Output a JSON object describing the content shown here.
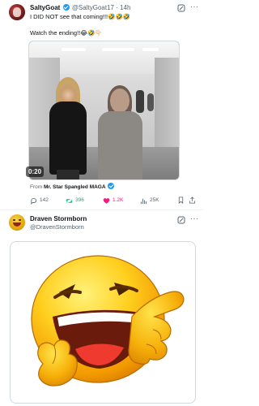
{
  "tweet1": {
    "author_name": "SaltyGoat",
    "handle": "@SaltyGoat17",
    "time": "14h",
    "text_line1": "I DID NOT see that coming!!!🤣🤣🤣",
    "text_line2": "Watch the ending!!😂🤣👇🏻",
    "video": {
      "duration": "0:20"
    },
    "from_prefix": "From",
    "from_source": "Mr. Star Spangled MAGA",
    "actions": {
      "replies": "142",
      "reposts": "396",
      "likes": "1.2K",
      "views": "25K"
    },
    "colors": {
      "verified": "#1d9bf0",
      "repost": "#00ba7c",
      "like": "#f91880"
    }
  },
  "tweet2": {
    "author_name": "Draven Stormborn",
    "handle": "@DravenStormborn",
    "image_icon": "laughing-pointing-emoji"
  },
  "icons": {
    "menu": "···",
    "grok": "grok-icon",
    "reply": "reply-icon",
    "repost": "repost-icon",
    "like": "heart-icon",
    "views": "views-icon",
    "bookmark": "bookmark-icon",
    "share": "share-icon"
  }
}
